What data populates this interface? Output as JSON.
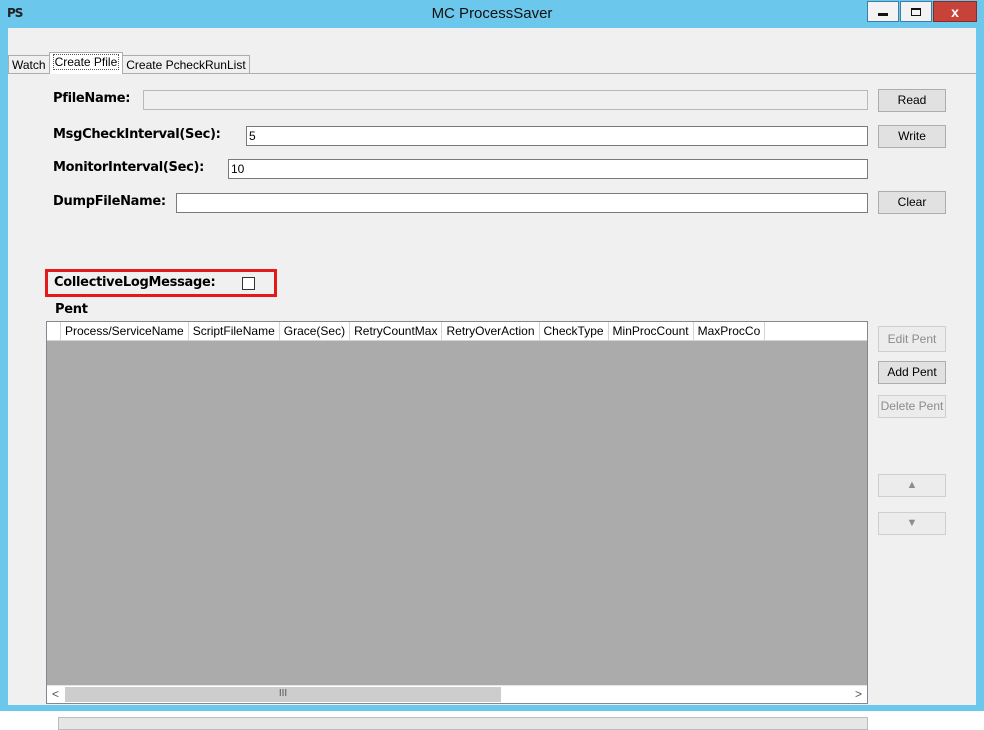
{
  "window": {
    "app_icon": "PS",
    "title": "MC ProcessSaver",
    "close_label": "x"
  },
  "tabs": [
    {
      "label": "Watch"
    },
    {
      "label": "Create Pfile"
    },
    {
      "label": "Create PcheckRunList"
    }
  ],
  "form": {
    "pfile_label": "PfileName:",
    "pfile_value": "",
    "msg_label": "MsgCheckInterval(Sec):",
    "msg_value": "5",
    "monitor_label": "MonitorInterval(Sec):",
    "monitor_value": "10",
    "dump_label": "DumpFileName:",
    "dump_value": "",
    "collective_label": "CollectiveLogMessage:",
    "collective_checked": false,
    "pent_label": "Pent"
  },
  "buttons": {
    "read": "Read",
    "write": "Write",
    "clear": "Clear",
    "edit_pent": "Edit Pent",
    "add_pent": "Add Pent",
    "delete_pent": "Delete Pent",
    "up": "▲",
    "down": "▼"
  },
  "grid": {
    "columns": [
      "Process/ServiceName",
      "ScriptFileName",
      "Grace(Sec)",
      "RetryCountMax",
      "RetryOverAction",
      "CheckType",
      "MinProcCount",
      "MaxProcCo"
    ],
    "rows": [],
    "scroll_left": "<",
    "scroll_right": ">",
    "scroll_thumb": "III"
  },
  "colors": {
    "titlebar": "#6cc7ec",
    "highlight": "#e31a1a",
    "grid_bg": "#ababab"
  }
}
